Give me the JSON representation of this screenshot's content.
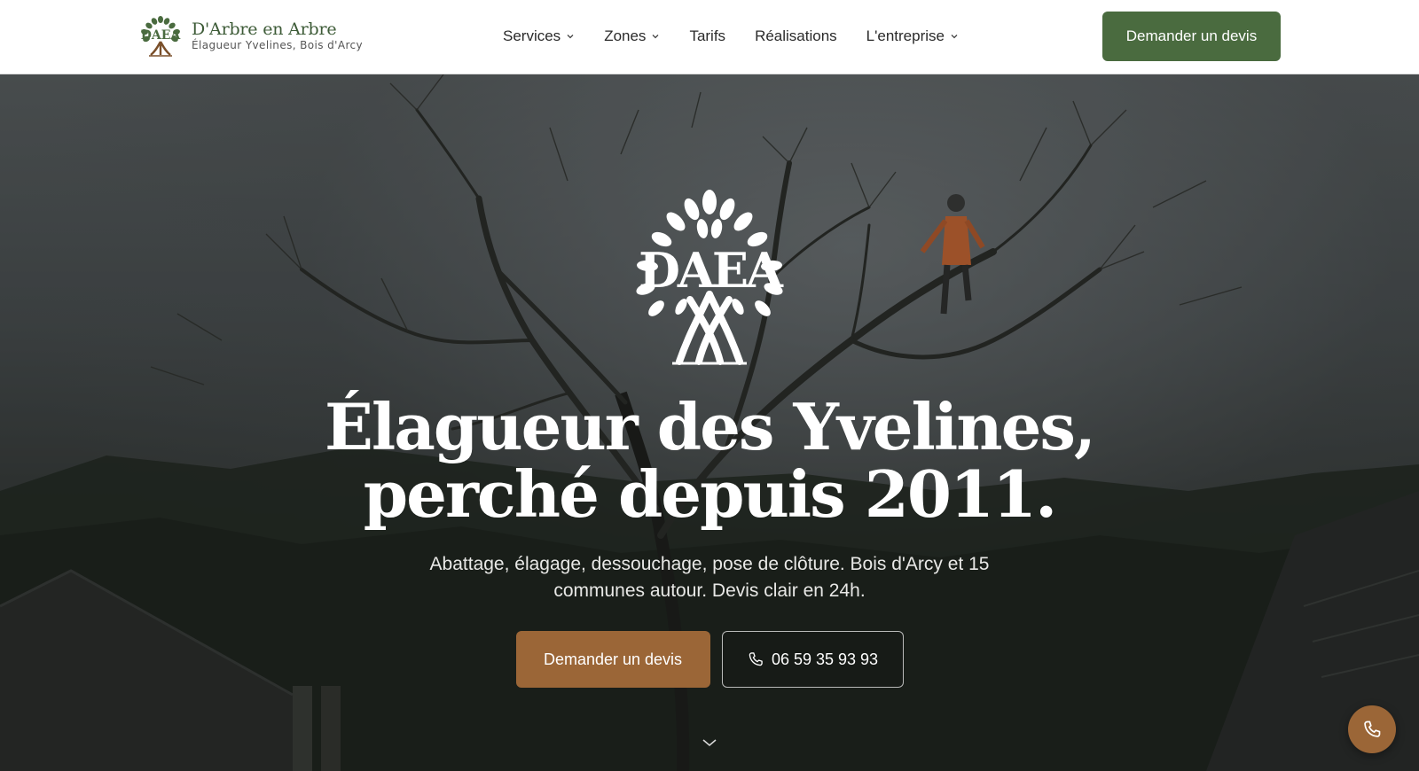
{
  "header": {
    "brand_name": "D'Arbre en Arbre",
    "brand_tagline": "Élagueur Yvelines, Bois d'Arcy",
    "logo_icon": "daea-tree-logo-icon",
    "nav": [
      {
        "label": "Services",
        "has_dropdown": true
      },
      {
        "label": "Zones",
        "has_dropdown": true
      },
      {
        "label": "Tarifs",
        "has_dropdown": false
      },
      {
        "label": "Réalisations",
        "has_dropdown": false
      },
      {
        "label": "L'entreprise",
        "has_dropdown": true
      }
    ],
    "cta_label": "Demander un devis"
  },
  "hero": {
    "logo_icon": "daea-tree-emblem-icon",
    "title_line1": "Élagueur des Yvelines,",
    "title_line2": "perché depuis 2011.",
    "subtitle": "Abattage, élagage, dessouchage, pose de clôture. Bois d'Arcy et 15 communes autour. Devis clair en 24h.",
    "primary_cta": "Demander un devis",
    "phone_cta": "06 59 35 93 93",
    "phone_icon": "phone-icon",
    "scroll_icon": "chevron-down-icon"
  },
  "fab": {
    "icon": "phone-icon"
  },
  "colors": {
    "brand_green": "#4a6b3f",
    "brand_brown": "#9b6637",
    "header_bg": "#ffffff",
    "text_dark": "#2a2a2a"
  }
}
